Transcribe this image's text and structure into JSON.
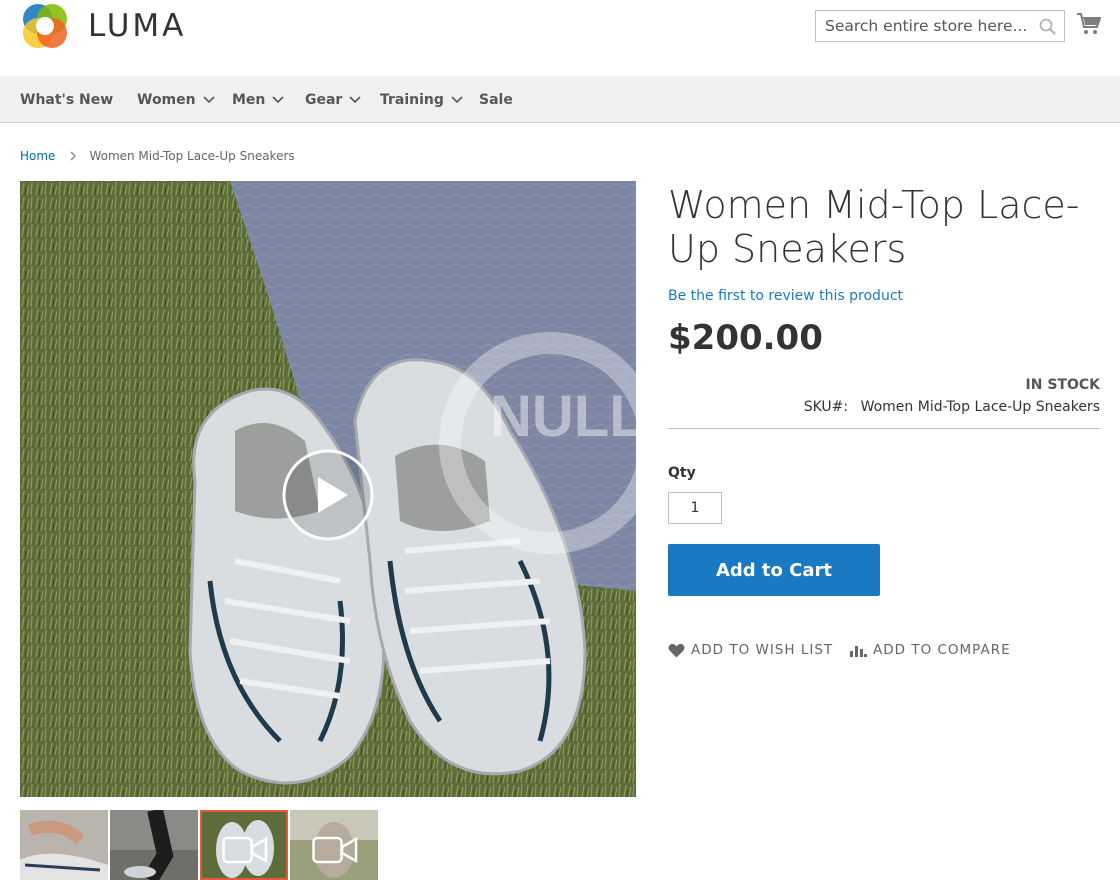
{
  "brand": {
    "name": "LUMA",
    "colors": {
      "orange": "#f26322",
      "yellow": "#f7c524",
      "green": "#7fba00",
      "blue": "#1979c3"
    }
  },
  "search": {
    "placeholder": "Search entire store here...",
    "value": ""
  },
  "icons": {
    "search": "search-icon",
    "cart": "cart-icon",
    "chevron": "chevron-down-icon",
    "breadcrumb_sep": "chevron-right-icon",
    "wishlist": "heart-icon",
    "compare": "bar-chart-icon",
    "play": "play-icon",
    "video": "video-camera-icon"
  },
  "nav": {
    "items": [
      {
        "label": "What's New",
        "has_dropdown": false
      },
      {
        "label": "Women",
        "has_dropdown": true
      },
      {
        "label": "Men",
        "has_dropdown": true
      },
      {
        "label": "Gear",
        "has_dropdown": true
      },
      {
        "label": "Training",
        "has_dropdown": true
      },
      {
        "label": "Sale",
        "has_dropdown": false
      }
    ]
  },
  "breadcrumb": {
    "home": "Home",
    "current": "Women Mid-Top Lace-Up Sneakers"
  },
  "product": {
    "title": "Women Mid-Top Lace-Up Sneakers",
    "review_link": "Be the first to review this product",
    "price": "$200.00",
    "stock": "In stock",
    "sku_label": "SKU#:",
    "sku_value": "Women Mid-Top Lace-Up Sneakers",
    "qty_label": "Qty",
    "qty_value": "1",
    "add_to_cart": "Add to Cart",
    "add_to_wishlist": "ADD TO WISH LIST",
    "add_to_compare": "ADD TO COMPARE"
  },
  "gallery": {
    "watermark": "NULLPRO",
    "thumbnails": [
      {
        "kind": "image",
        "active": false
      },
      {
        "kind": "image",
        "active": false
      },
      {
        "kind": "video",
        "active": true
      },
      {
        "kind": "video",
        "active": false
      }
    ]
  }
}
